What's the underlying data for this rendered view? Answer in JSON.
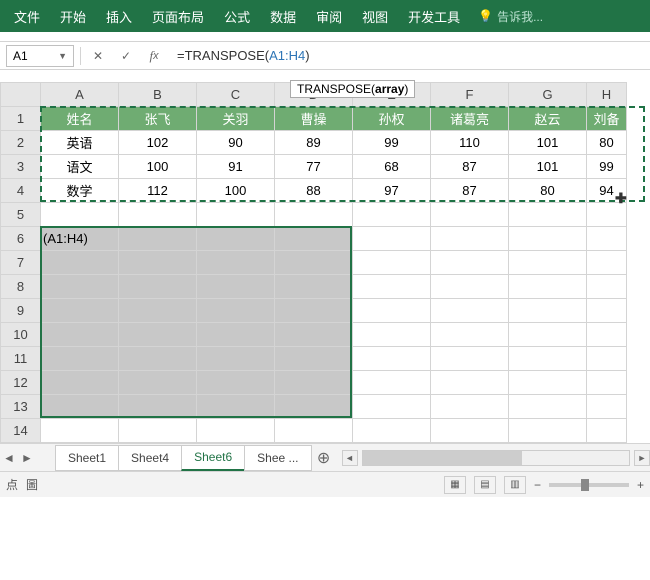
{
  "ribbon": {
    "tabs": [
      "文件",
      "开始",
      "插入",
      "页面布局",
      "公式",
      "数据",
      "审阅",
      "视图",
      "开发工具"
    ],
    "tell_me": "告诉我..."
  },
  "formula_bar": {
    "name_box": "A1",
    "formula_prefix": "=TRANSPOSE(",
    "formula_ref": "A1:H4",
    "formula_suffix": ")",
    "tooltip_fn": "TRANSPOSE",
    "tooltip_arg": "array"
  },
  "columns": [
    "A",
    "B",
    "C",
    "D",
    "E",
    "F",
    "G",
    "H"
  ],
  "rows": [
    "1",
    "2",
    "3",
    "4",
    "5",
    "6",
    "7",
    "8",
    "9",
    "10",
    "11",
    "12",
    "13",
    "14"
  ],
  "table": {
    "header": [
      "姓名",
      "张飞",
      "关羽",
      "曹操",
      "孙权",
      "诸葛亮",
      "赵云",
      "刘备"
    ],
    "data": [
      [
        "英语",
        "102",
        "90",
        "89",
        "99",
        "110",
        "101",
        "80"
      ],
      [
        "语文",
        "100",
        "91",
        "77",
        "68",
        "87",
        "101",
        "99"
      ],
      [
        "数学",
        "112",
        "100",
        "88",
        "97",
        "87",
        "80",
        "94"
      ]
    ]
  },
  "cell_a6": "(A1:H4)",
  "sheets": {
    "tabs": [
      "Sheet1",
      "Sheet4",
      "Sheet6",
      "Shee ..."
    ],
    "active": "Sheet6"
  },
  "status": {
    "left1": "点",
    "left2": "圖"
  },
  "colors": {
    "ribbon": "#217346",
    "header_row": "#6fac72"
  }
}
